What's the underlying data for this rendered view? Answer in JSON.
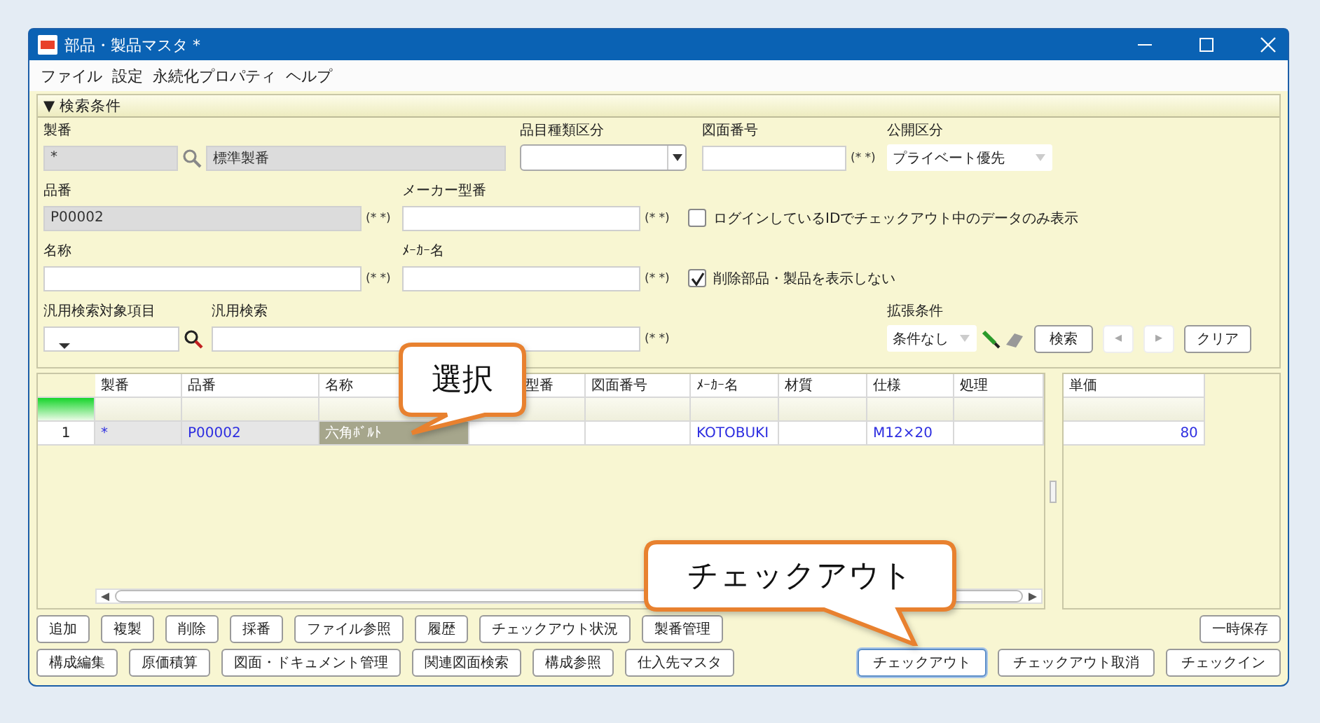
{
  "window": {
    "title": "部品・製品マスタ *"
  },
  "menu": [
    "ファイル",
    "設定",
    "永続化プロパティ",
    "ヘルプ"
  ],
  "search_panel": {
    "title": "▼ 検索条件",
    "seiban": {
      "label": "製番",
      "value": "*",
      "name_value": "標準製番"
    },
    "item_type": {
      "label": "品目種類区分"
    },
    "drawing_no": {
      "label": "図面番号",
      "suffix": "(* *)"
    },
    "visibility": {
      "label": "公開区分",
      "value": "プライベート優先"
    },
    "part_no": {
      "label": "品番",
      "value": "P00002",
      "suffix": "(* *)"
    },
    "maker_model": {
      "label": "メーカー型番",
      "suffix": "(* *)"
    },
    "checkout_only": {
      "label": "ログインしているIDでチェックアウト中のデータのみ表示",
      "checked": false
    },
    "name": {
      "label": "名称",
      "suffix": "(* *)"
    },
    "maker_name": {
      "label": "ﾒｰｶｰ名",
      "suffix": "(* *)"
    },
    "hide_deleted": {
      "label": "削除部品・製品を表示しない",
      "checked": true
    },
    "generic_target": {
      "label": "汎用検索対象項目"
    },
    "generic_search": {
      "label": "汎用検索",
      "suffix": "(* *)"
    },
    "extended": {
      "label": "拡張条件",
      "value": "条件なし"
    },
    "buttons": [
      {
        "label": "検索",
        "disabled": false
      },
      {
        "label": "◂",
        "disabled": true
      },
      {
        "label": "▸",
        "disabled": true
      },
      {
        "label": "クリア",
        "disabled": false
      }
    ]
  },
  "table": {
    "columns": [
      "製番",
      "品番",
      "名称",
      "型番",
      "図面番号",
      "ﾒｰｶｰ名",
      "材質",
      "仕様",
      "処理"
    ],
    "rows": [
      {
        "number": "1",
        "cells": [
          {
            "text": "*",
            "readonly": true,
            "selected": false
          },
          {
            "text": "P00002",
            "readonly": true,
            "selected": false
          },
          {
            "text": "六角ﾎﾞﾙﾄ",
            "readonly": false,
            "selected": true
          },
          {
            "readonly": false,
            "selected": false
          },
          {
            "readonly": false,
            "selected": false
          },
          {
            "text": "KOTOBUKI",
            "readonly": false,
            "selected": false
          },
          {
            "readonly": false,
            "selected": false
          },
          {
            "text": "M12×20",
            "readonly": false,
            "selected": false
          },
          {
            "readonly": false,
            "selected": false
          }
        ]
      }
    ]
  },
  "price_table": {
    "columns": [
      "単価"
    ],
    "rows": [
      {
        "cells": [
          {
            "text": "80"
          }
        ]
      }
    ]
  },
  "buttons_row1": [
    {
      "label": "追加"
    },
    {
      "label": "複製"
    },
    {
      "label": "削除"
    },
    {
      "label": "採番"
    },
    {
      "label": "ファイル参照"
    },
    {
      "label": "履歴"
    },
    {
      "label": "チェックアウト状況"
    },
    {
      "label": "製番管理"
    }
  ],
  "buttons_row1_right": [
    {
      "label": "一時保存"
    }
  ],
  "buttons_row2": [
    {
      "label": "構成編集"
    },
    {
      "label": "原価積算"
    },
    {
      "label": "図面・ドキュメント管理"
    },
    {
      "label": "関連図面検索"
    },
    {
      "label": "構成参照"
    },
    {
      "label": "仕入先マスタ"
    }
  ],
  "buttons_row2_right": [
    {
      "label": "チェックアウト",
      "focused": true
    },
    {
      "label": "チェックアウト取消",
      "focused": false
    },
    {
      "label": "チェックイン",
      "focused": false
    }
  ],
  "callouts": [
    {
      "text": "選択"
    },
    {
      "text": "チェックアウト"
    }
  ]
}
